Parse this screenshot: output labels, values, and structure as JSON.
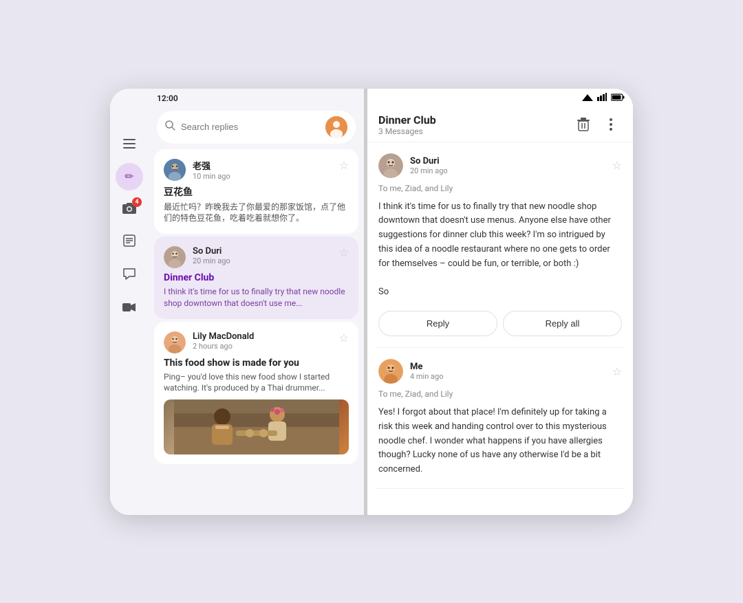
{
  "left": {
    "status_bar": {
      "time": "12:00"
    },
    "search": {
      "placeholder": "Search replies"
    },
    "sidebar": {
      "items": [
        {
          "name": "menu",
          "icon": "☰",
          "active": false
        },
        {
          "name": "compose",
          "icon": "✏",
          "active": true
        },
        {
          "name": "inbox",
          "icon": "📷",
          "active": false,
          "badge": "4"
        },
        {
          "name": "notes",
          "icon": "☰",
          "active": false
        },
        {
          "name": "chat",
          "icon": "💬",
          "active": false
        },
        {
          "name": "video",
          "icon": "▶",
          "active": false
        }
      ]
    },
    "messages": [
      {
        "id": "msg1",
        "sender": "老强",
        "time": "10 min ago",
        "subject": "豆花鱼",
        "preview": "最近忙吗？昨晚我去了你最爱的那家饭馆，点了他们的特色豆花鱼，吃着吃着就想你了。",
        "selected": false,
        "avatar_color": "av-laozhuang"
      },
      {
        "id": "msg2",
        "sender": "So Duri",
        "time": "20 min ago",
        "subject": "Dinner Club",
        "preview": "I think it's time for us to finally try that new noodle shop downtown that doesn't use me...",
        "selected": true,
        "avatar_color": "av-soduri"
      },
      {
        "id": "msg3",
        "sender": "Lily MacDonald",
        "time": "2 hours ago",
        "subject": "This food show is made for you",
        "preview": "Ping– you'd love this new food show I started watching. It's produced by a Thai drummer...",
        "selected": false,
        "avatar_color": "av-lily",
        "has_image": true
      }
    ]
  },
  "right": {
    "status_bar": {
      "wifi": "▲",
      "signal": "▲",
      "battery": "🔋"
    },
    "thread": {
      "title": "Dinner Club",
      "count": "3 Messages",
      "delete_label": "Delete",
      "more_label": "More"
    },
    "emails": [
      {
        "id": "email1",
        "sender": "So Duri",
        "time": "20 min ago",
        "to": "To me, Ziad, and Lily",
        "body": "I think it's time for us to finally try that new noodle shop downtown that doesn't use menus. Anyone else have other suggestions for dinner club this week? I'm so intrigued by this idea of a noodle restaurant where no one gets to order for themselves – could be fun, or terrible, or both :)\n\nSo",
        "avatar_color": "av-soduri",
        "show_reply_buttons": true
      },
      {
        "id": "email2",
        "sender": "Me",
        "time": "4 min ago",
        "to": "To me, Ziad, and Lily",
        "body": "Yes! I forgot about that place! I'm definitely up for taking a risk this week and handing control over to this mysterious noodle chef. I wonder what happens if you have allergies though? Lucky none of us have any otherwise I'd be a bit concerned.",
        "avatar_color": "av-me",
        "show_reply_buttons": false
      }
    ],
    "reply_buttons": {
      "reply": "Reply",
      "reply_all": "Reply all"
    }
  }
}
